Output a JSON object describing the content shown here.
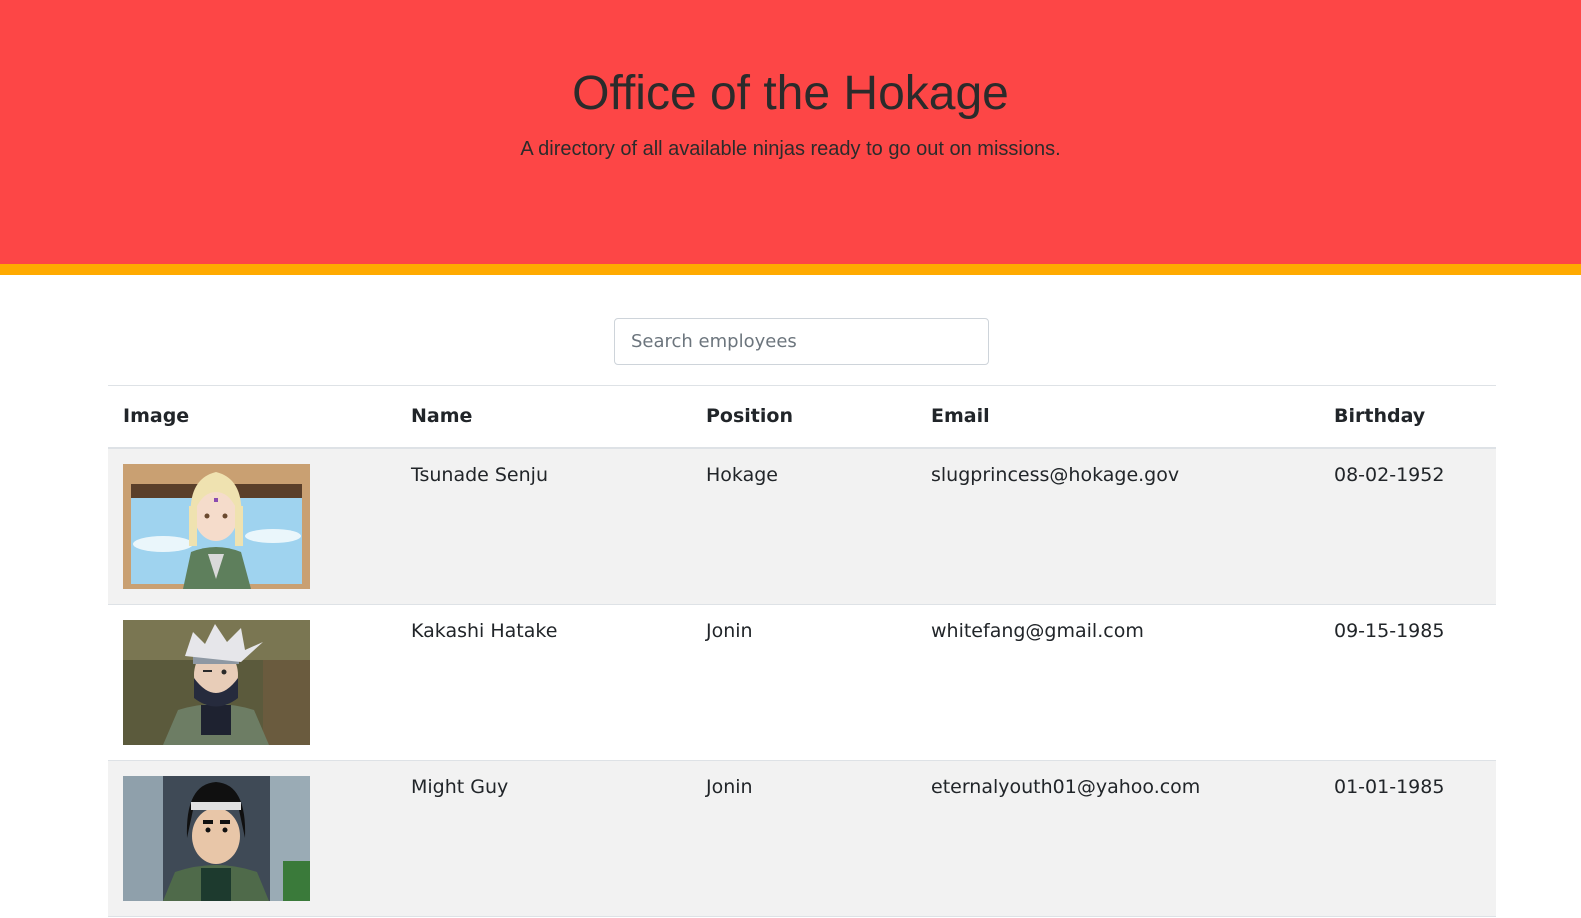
{
  "header": {
    "title": "Office of the Hokage",
    "subtitle": "A directory of all available ninjas ready to go out on missions."
  },
  "search": {
    "placeholder": "Search employees",
    "value": ""
  },
  "table": {
    "columns": [
      "Image",
      "Name",
      "Position",
      "Email",
      "Birthday"
    ],
    "rows": [
      {
        "image": "portrait-tsunade",
        "name": "Tsunade Senju",
        "position": "Hokage",
        "email": "slugprincess@hokage.gov",
        "birthday": "08-02-1952"
      },
      {
        "image": "portrait-kakashi",
        "name": "Kakashi Hatake",
        "position": "Jonin",
        "email": "whitefang@gmail.com",
        "birthday": "09-15-1985"
      },
      {
        "image": "portrait-might-guy",
        "name": "Might Guy",
        "position": "Jonin",
        "email": "eternalyouth01@yahoo.com",
        "birthday": "01-01-1985"
      }
    ]
  },
  "colors": {
    "hero": "#fd4646",
    "accent": "#ffaa00",
    "stripe": "#f2f2f2"
  }
}
